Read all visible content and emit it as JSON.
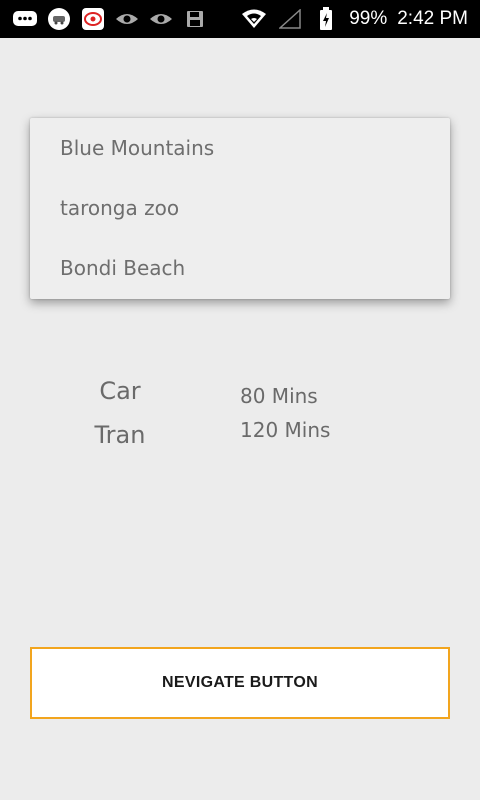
{
  "status_bar": {
    "icons_left": [
      "chat-icon",
      "app-icon",
      "app-icon",
      "eye-icon",
      "eye-icon",
      "save-icon"
    ],
    "battery": "99%",
    "time": "2:42 PM"
  },
  "dropdown": {
    "items": [
      {
        "label": "Blue Mountains"
      },
      {
        "label": "taronga zoo"
      },
      {
        "label": "Bondi Beach"
      }
    ]
  },
  "travel": [
    {
      "mode": "Car",
      "duration": "80 Mins"
    },
    {
      "mode": "Tran",
      "duration": "120 Mins"
    }
  ],
  "nav_button": {
    "label": "NEVIGATE BUTTON"
  },
  "colors": {
    "accent": "#f2a51e",
    "background": "#ececec",
    "text": "#6e6e6e"
  }
}
